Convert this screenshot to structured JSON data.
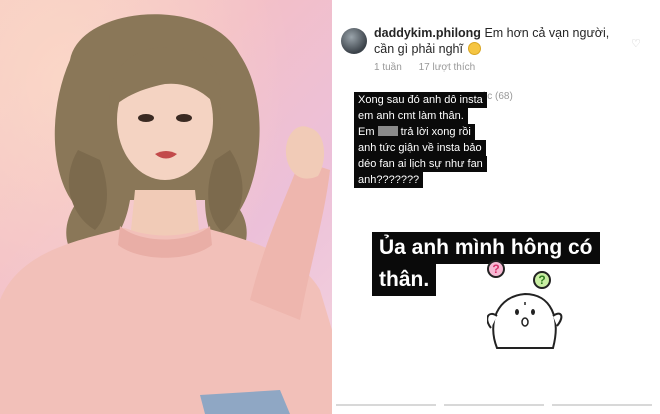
{
  "comment": {
    "username": "daddykim.philong",
    "text": "Em hơn cả vạn người, cần gì phải nghĩ",
    "emoji_icon": "smirk-emoji-icon",
    "time": "1 tuần",
    "likes": "17 lượt thích",
    "replies_label": "ước (68)"
  },
  "story_caption": {
    "lines": [
      "Xong sau đó anh dô insta",
      "em anh cmt làm thân.",
      "Em ",
      " trả lời xong rồi",
      "anh tức giận về insta bảo",
      "déo fan ai lịch sự như fan",
      "anh???????"
    ]
  },
  "story_big": {
    "lines": [
      "Ủa anh mình hông có",
      "thân."
    ]
  },
  "stickers": {
    "bubble_left": "?",
    "bubble_right": "?"
  },
  "colors": {
    "bg_pink": "#f3bfc8",
    "caption_bg": "#0a0a0a",
    "caption_text": "#ffffff"
  }
}
